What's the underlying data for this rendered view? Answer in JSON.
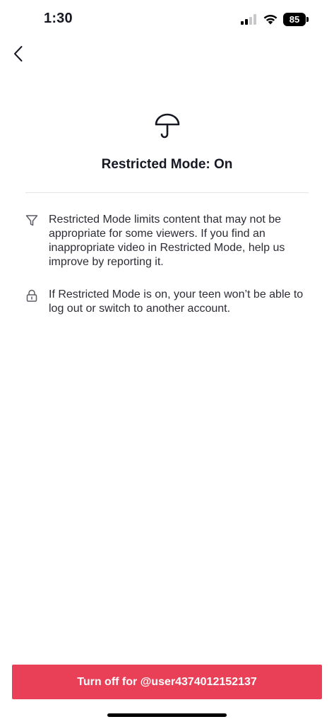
{
  "status_bar": {
    "time": "1:30",
    "battery_level": "85",
    "signal_icon": "cellular-signal-icon",
    "wifi_icon": "wifi-icon"
  },
  "header": {
    "back_icon": "chevron-left-icon"
  },
  "hero": {
    "icon": "umbrella-icon",
    "title": "Restricted Mode: On"
  },
  "info_items": [
    {
      "icon": "filter-icon",
      "text": "Restricted Mode limits content that may not be appropriate for some viewers. If you find an inappropriate video in Restricted Mode, help us improve by reporting it."
    },
    {
      "icon": "lock-icon",
      "text": "If Restricted Mode is on, your teen won’t be able to log out or switch to another account."
    }
  ],
  "action": {
    "label": "Turn off for @user4374012152137",
    "color": "#ea4057"
  }
}
